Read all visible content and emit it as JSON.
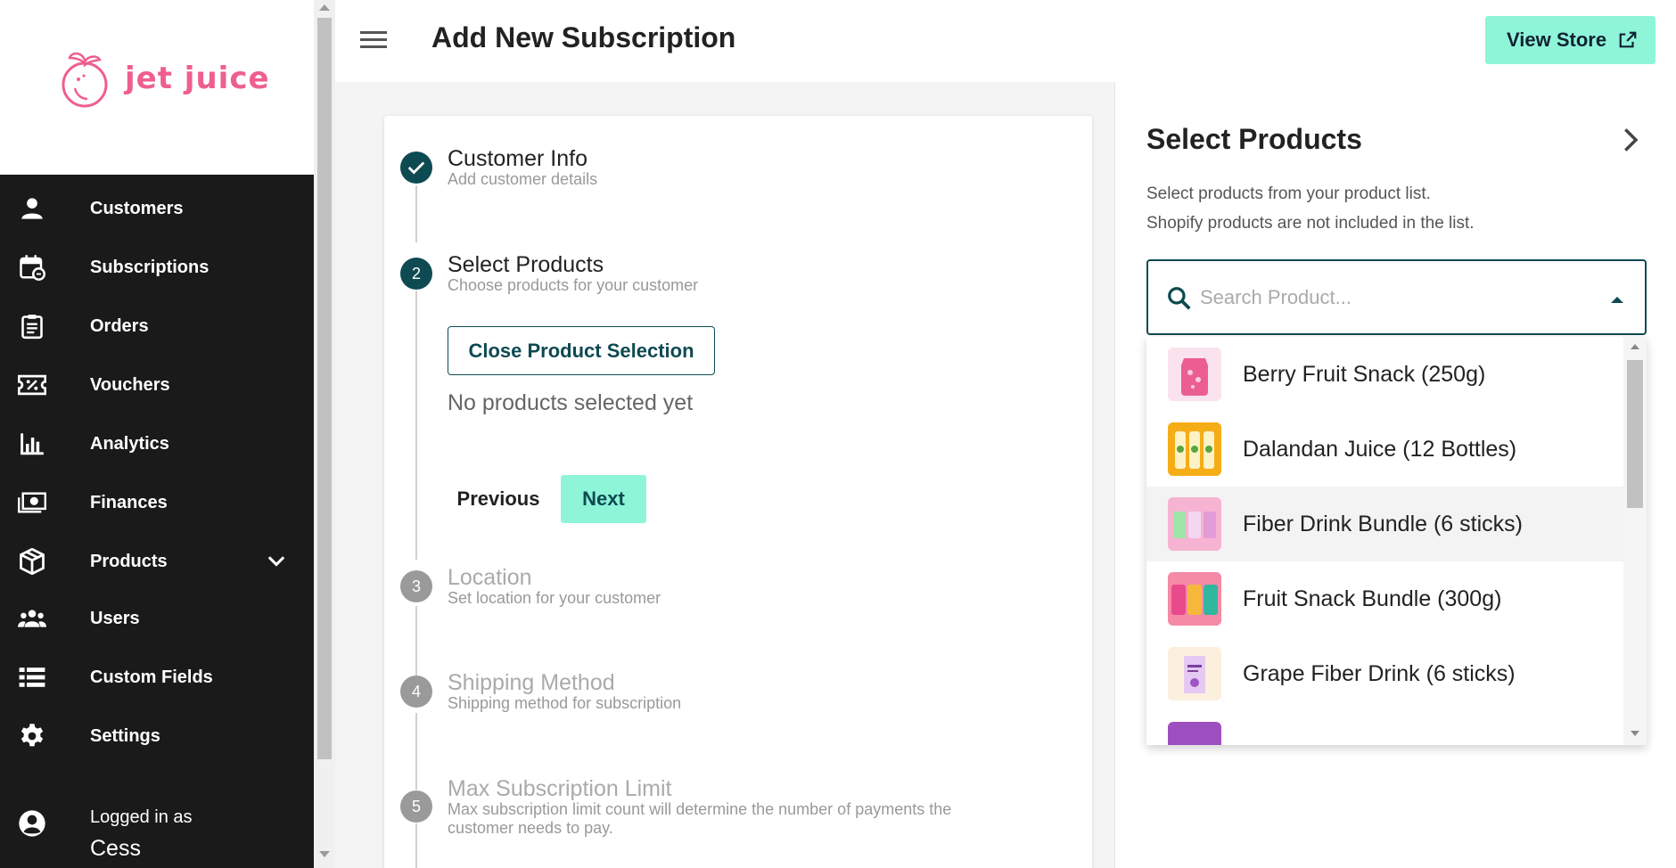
{
  "brand": {
    "name": "jet juice",
    "color": "#ee5f8e"
  },
  "header": {
    "title": "Add New Subscription",
    "view_store": "View Store"
  },
  "sidebar": {
    "items": [
      {
        "label": "Customers",
        "icon": "person-icon"
      },
      {
        "label": "Subscriptions",
        "icon": "calendar-sync-icon"
      },
      {
        "label": "Orders",
        "icon": "clipboard-icon"
      },
      {
        "label": "Vouchers",
        "icon": "voucher-icon"
      },
      {
        "label": "Analytics",
        "icon": "bar-chart-icon"
      },
      {
        "label": "Finances",
        "icon": "money-icon"
      },
      {
        "label": "Products",
        "icon": "box-icon"
      },
      {
        "label": "Users",
        "icon": "group-icon"
      },
      {
        "label": "Custom Fields",
        "icon": "list-icon"
      },
      {
        "label": "Settings",
        "icon": "gear-icon"
      }
    ],
    "logged_in_label": "Logged in as",
    "user_name": "Cess"
  },
  "stepper": {
    "steps": [
      {
        "number": "1",
        "title": "Customer Info",
        "subtitle": "Add customer details",
        "state": "completed"
      },
      {
        "number": "2",
        "title": "Select Products",
        "subtitle": "Choose products for your customer",
        "state": "active"
      },
      {
        "number": "3",
        "title": "Location",
        "subtitle": "Set location for your customer",
        "state": "inactive"
      },
      {
        "number": "4",
        "title": "Shipping Method",
        "subtitle": "Shipping method for subscription",
        "state": "inactive"
      },
      {
        "number": "5",
        "title": "Max Subscription Limit",
        "subtitle_line1": "Max subscription limit count will determine the number of payments the",
        "subtitle_line2": "customer needs to pay.",
        "state": "inactive"
      }
    ],
    "close_selection": "Close Product Selection",
    "no_products": "No products selected yet",
    "previous": "Previous",
    "next": "Next"
  },
  "select_panel": {
    "title": "Select Products",
    "desc_line1": "Select products from your product list.",
    "desc_line2": "Shopify products are not included in the list.",
    "search_placeholder": "Search Product...",
    "products": [
      "Berry Fruit Snack (250g)",
      "Dalandan Juice (12 Bottles)",
      "Fiber Drink Bundle (6 sticks)",
      "Fruit Snack Bundle (300g)",
      "Grape Fiber Drink (6 sticks)"
    ]
  },
  "colors": {
    "accent": "#8ff5d8",
    "primary": "#0e4a52",
    "sidebar": "#1a1a1a"
  }
}
